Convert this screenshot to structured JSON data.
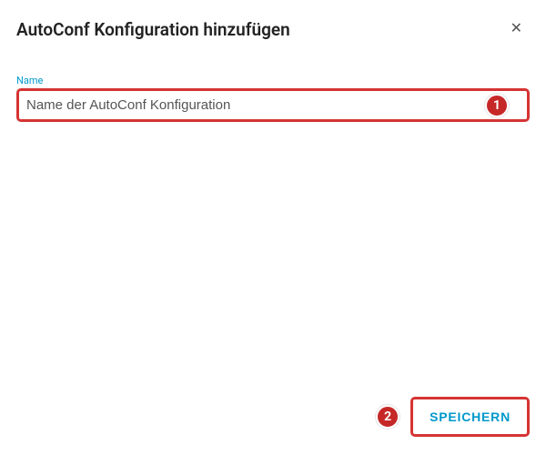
{
  "dialog": {
    "title": "AutoConf Konfiguration hinzufügen",
    "close_icon": "✕"
  },
  "field": {
    "label": "Name",
    "placeholder": "Name der AutoConf Konfiguration",
    "value": ""
  },
  "markers": {
    "one": "1",
    "two": "2"
  },
  "actions": {
    "save_label": "SPEICHERN"
  },
  "colors": {
    "accent": "#0099cc",
    "annotation": "#d63333",
    "marker_fill": "#c62828"
  }
}
